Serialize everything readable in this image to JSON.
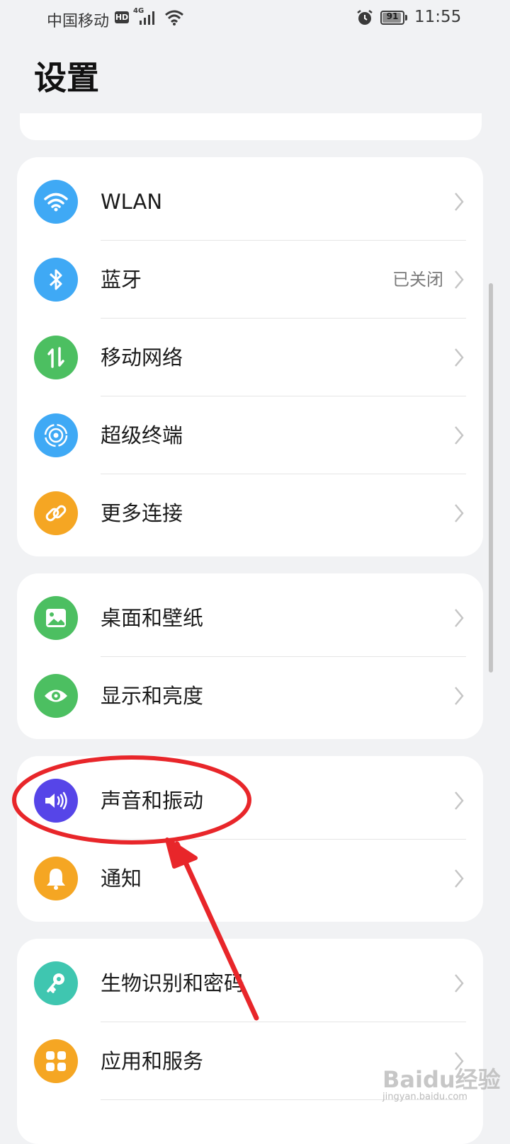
{
  "status_bar": {
    "carrier": "中国移动",
    "hd_badge": "HD",
    "network_type": "4G",
    "battery_level": "91",
    "time": "11:55"
  },
  "page": {
    "title": "设置"
  },
  "groups": [
    {
      "items": [
        {
          "label": "WLAN",
          "value": "",
          "icon": "wifi-icon",
          "icon_color": "#3fa9f5"
        },
        {
          "label": "蓝牙",
          "value": "已关闭",
          "icon": "bluetooth-icon",
          "icon_color": "#3fa9f5"
        },
        {
          "label": "移动网络",
          "value": "",
          "icon": "mobile-data-icon",
          "icon_color": "#4cbf61"
        },
        {
          "label": "超级终端",
          "value": "",
          "icon": "super-device-icon",
          "icon_color": "#3fa9f5"
        },
        {
          "label": "更多连接",
          "value": "",
          "icon": "link-icon",
          "icon_color": "#f5a623"
        }
      ]
    },
    {
      "items": [
        {
          "label": "桌面和壁纸",
          "value": "",
          "icon": "wallpaper-icon",
          "icon_color": "#4cbf61"
        },
        {
          "label": "显示和亮度",
          "value": "",
          "icon": "eye-icon",
          "icon_color": "#4cbf61"
        }
      ]
    },
    {
      "items": [
        {
          "label": "声音和振动",
          "value": "",
          "icon": "speaker-icon",
          "icon_color": "#5645e8"
        },
        {
          "label": "通知",
          "value": "",
          "icon": "bell-icon",
          "icon_color": "#f5a623"
        }
      ]
    },
    {
      "items": [
        {
          "label": "生物识别和密码",
          "value": "",
          "icon": "key-icon",
          "icon_color": "#3fc6b0"
        },
        {
          "label": "应用和服务",
          "value": "",
          "icon": "apps-icon",
          "icon_color": "#f5a623"
        }
      ]
    }
  ],
  "annotation": {
    "color": "#e8262a"
  },
  "watermark": {
    "text": "Baidu经验",
    "subtext": "jingyan.baidu.com"
  }
}
